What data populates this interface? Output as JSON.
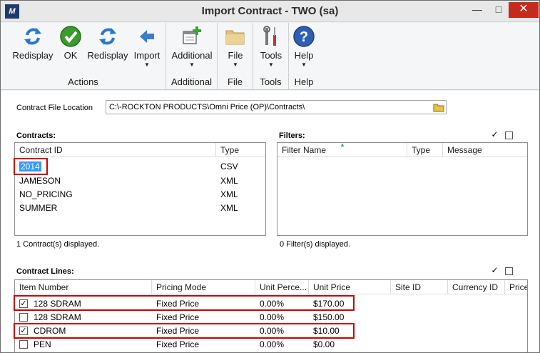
{
  "window": {
    "title": "Import Contract  -  TWO (sa)",
    "app_icon": "dynamics-logo-icon"
  },
  "ribbon": {
    "groups": [
      {
        "label": "Actions",
        "buttons": [
          {
            "label": "Redisplay",
            "icon": "refresh-icon"
          },
          {
            "label": "OK",
            "icon": "check-icon"
          },
          {
            "label": "Redisplay",
            "icon": "refresh-icon"
          },
          {
            "label": "Import",
            "icon": "arrow-left-icon"
          }
        ]
      },
      {
        "label": "Additional",
        "buttons": [
          {
            "label": "Additional",
            "icon": "add-window-icon"
          }
        ]
      },
      {
        "label": "File",
        "buttons": [
          {
            "label": "File",
            "icon": "folder-icon"
          }
        ]
      },
      {
        "label": "Tools",
        "buttons": [
          {
            "label": "Tools",
            "icon": "tools-icon"
          }
        ]
      },
      {
        "label": "Help",
        "buttons": [
          {
            "label": "Help",
            "icon": "help-icon"
          }
        ]
      }
    ]
  },
  "file_location": {
    "label": "Contract File Location",
    "value": "C:\\-ROCKTON PRODUCTS\\Omni Price (OP)\\Contracts\\"
  },
  "contracts": {
    "title": "Contracts:",
    "columns": [
      "Contract ID",
      "Type"
    ],
    "rows": [
      {
        "id": "2014",
        "type": "CSV"
      },
      {
        "id": "JAMESON",
        "type": "XML"
      },
      {
        "id": "NO_PRICING",
        "type": "XML"
      },
      {
        "id": "SUMMER",
        "type": "XML"
      }
    ],
    "status": "1 Contract(s) displayed."
  },
  "filters": {
    "title": "Filters:",
    "columns": [
      "Filter Name",
      "Type",
      "Message"
    ],
    "status": "0 Filter(s) displayed."
  },
  "contract_lines": {
    "title": "Contract Lines:",
    "columns": [
      "Item Number",
      "Pricing Mode",
      "Unit Perce...",
      "Unit Price",
      "Site ID",
      "Currency ID",
      "Price"
    ],
    "rows": [
      {
        "checked": true,
        "item": "128 SDRAM",
        "mode": "Fixed Price",
        "percent": "0.00%",
        "price": "$170.00"
      },
      {
        "checked": false,
        "item": "128 SDRAM",
        "mode": "Fixed Price",
        "percent": "0.00%",
        "price": "$150.00"
      },
      {
        "checked": true,
        "item": "CDROM",
        "mode": "Fixed Price",
        "percent": "0.00%",
        "price": "$10.00"
      },
      {
        "checked": false,
        "item": "PEN",
        "mode": "Fixed Price",
        "percent": "0.00%",
        "price": "$0.00"
      }
    ]
  },
  "colors": {
    "accent": "#3399ff",
    "highlight": "#d00000",
    "close": "#c42b1c"
  }
}
